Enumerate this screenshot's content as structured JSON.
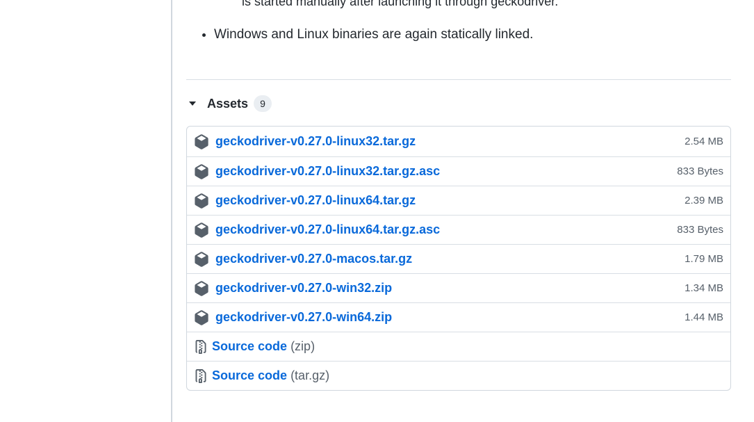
{
  "notes": {
    "cut_line": "is started manually after launching it through geckodriver.",
    "bullets": [
      "Windows and Linux binaries are again statically linked."
    ]
  },
  "assets": {
    "title": "Assets",
    "count": "9",
    "files": [
      {
        "name": "geckodriver-v0.27.0-linux32.tar.gz",
        "size": "2.54 MB"
      },
      {
        "name": "geckodriver-v0.27.0-linux32.tar.gz.asc",
        "size": "833 Bytes"
      },
      {
        "name": "geckodriver-v0.27.0-linux64.tar.gz",
        "size": "2.39 MB"
      },
      {
        "name": "geckodriver-v0.27.0-linux64.tar.gz.asc",
        "size": "833 Bytes"
      },
      {
        "name": "geckodriver-v0.27.0-macos.tar.gz",
        "size": "1.79 MB"
      },
      {
        "name": "geckodriver-v0.27.0-win32.zip",
        "size": "1.34 MB"
      },
      {
        "name": "geckodriver-v0.27.0-win64.zip",
        "size": "1.44 MB"
      }
    ],
    "source": [
      {
        "label": "Source code",
        "format": "(zip)"
      },
      {
        "label": "Source code",
        "format": "(tar.gz)"
      }
    ]
  },
  "icons": {
    "file": "package-icon",
    "source": "file-zip-icon",
    "toggle": "triangle-down-icon"
  },
  "colors": {
    "link": "#0969da",
    "muted": "#57606a",
    "border": "#d0d7de"
  }
}
